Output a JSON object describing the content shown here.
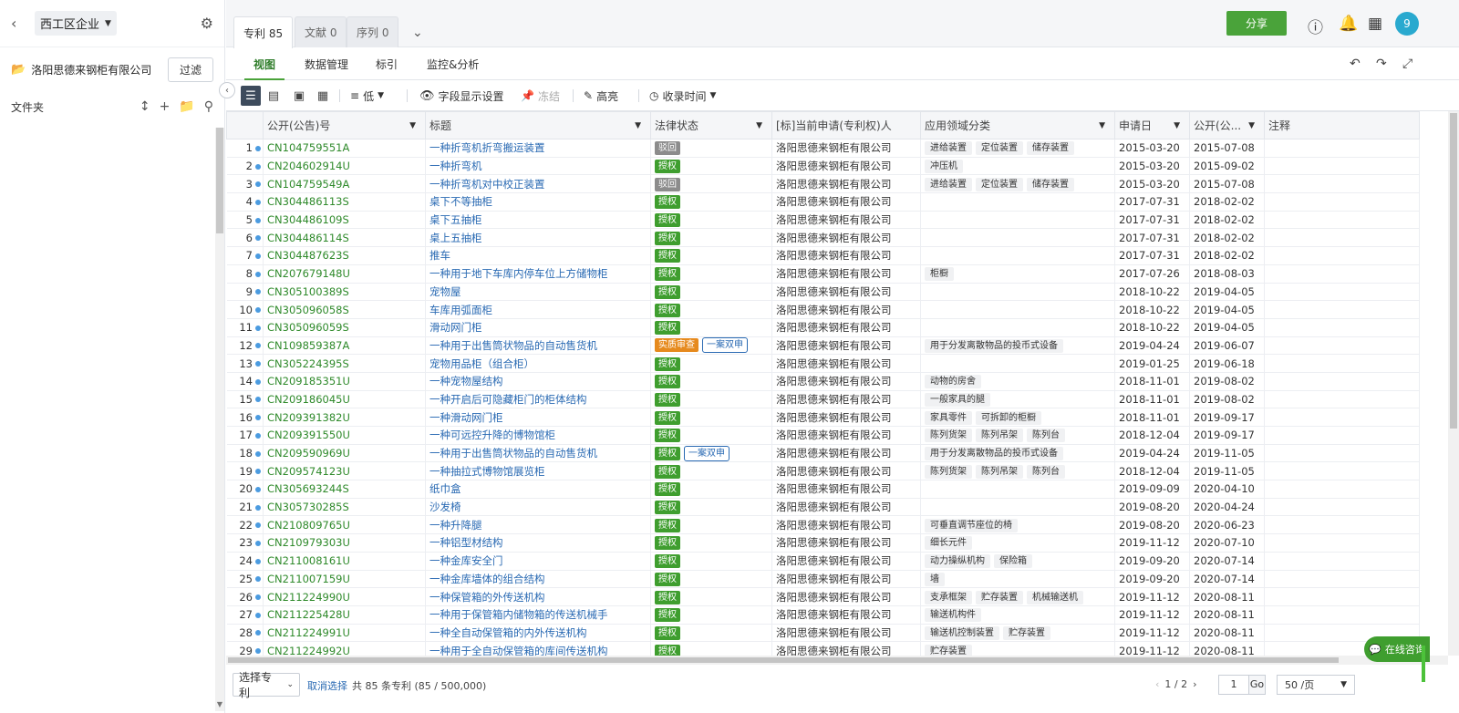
{
  "sidebar": {
    "group": "西工区企业",
    "org": "洛阳思德来钢柜有限公司",
    "filter_label": "过滤",
    "folder_label": "文件夹"
  },
  "tabs": [
    {
      "label": "专利 85"
    },
    {
      "label": "文献 0"
    },
    {
      "label": "序列 0"
    }
  ],
  "header": {
    "share_label": "分享",
    "avatar_text": "9"
  },
  "subtabs": [
    "视图",
    "数据管理",
    "标引",
    "监控&分析"
  ],
  "toolbar": {
    "priority_label": "低",
    "field_display_label": "字段显示设置",
    "freeze_label": "冻结",
    "highlight_label": "高亮",
    "collect_time_label": "收录时间"
  },
  "columns": [
    "公开(公告)号",
    "标题",
    "法律状态",
    "[标]当前申请(专利权)人",
    "应用领域分类",
    "申请日",
    "公开(公...",
    "注释"
  ],
  "rows": [
    {
      "n": "1",
      "pn": "CN104759551A",
      "title": "一种折弯机折弯搬运装置",
      "status": [
        {
          "t": "驳回",
          "c": "gray"
        }
      ],
      "owner": "洛阳思德来钢柜有限公司",
      "tags": [
        "进给装置",
        "定位装置",
        "储存装置"
      ],
      "app": "2015-03-20",
      "pub": "2015-07-08"
    },
    {
      "n": "2",
      "pn": "CN204602914U",
      "title": "一种折弯机",
      "status": [
        {
          "t": "授权",
          "c": "green"
        }
      ],
      "owner": "洛阳思德来钢柜有限公司",
      "tags": [
        "冲压机"
      ],
      "app": "2015-03-20",
      "pub": "2015-09-02"
    },
    {
      "n": "3",
      "pn": "CN104759549A",
      "title": "一种折弯机对中校正装置",
      "status": [
        {
          "t": "驳回",
          "c": "gray"
        }
      ],
      "owner": "洛阳思德来钢柜有限公司",
      "tags": [
        "进给装置",
        "定位装置",
        "储存装置"
      ],
      "app": "2015-03-20",
      "pub": "2015-07-08"
    },
    {
      "n": "4",
      "pn": "CN304486113S",
      "title": "桌下不等抽柜",
      "status": [
        {
          "t": "授权",
          "c": "green"
        }
      ],
      "owner": "洛阳思德来钢柜有限公司",
      "tags": [],
      "app": "2017-07-31",
      "pub": "2018-02-02"
    },
    {
      "n": "5",
      "pn": "CN304486109S",
      "title": "桌下五抽柜",
      "status": [
        {
          "t": "授权",
          "c": "green"
        }
      ],
      "owner": "洛阳思德来钢柜有限公司",
      "tags": [],
      "app": "2017-07-31",
      "pub": "2018-02-02"
    },
    {
      "n": "6",
      "pn": "CN304486114S",
      "title": "桌上五抽柜",
      "status": [
        {
          "t": "授权",
          "c": "green"
        }
      ],
      "owner": "洛阳思德来钢柜有限公司",
      "tags": [],
      "app": "2017-07-31",
      "pub": "2018-02-02"
    },
    {
      "n": "7",
      "pn": "CN304487623S",
      "title": "推车",
      "status": [
        {
          "t": "授权",
          "c": "green"
        }
      ],
      "owner": "洛阳思德来钢柜有限公司",
      "tags": [],
      "app": "2017-07-31",
      "pub": "2018-02-02"
    },
    {
      "n": "8",
      "pn": "CN207679148U",
      "title": "一种用于地下车库内停车位上方储物柜",
      "status": [
        {
          "t": "授权",
          "c": "green"
        }
      ],
      "owner": "洛阳思德来钢柜有限公司",
      "tags": [
        "柜橱"
      ],
      "app": "2017-07-26",
      "pub": "2018-08-03"
    },
    {
      "n": "9",
      "pn": "CN305100389S",
      "title": "宠物屋",
      "status": [
        {
          "t": "授权",
          "c": "green"
        }
      ],
      "owner": "洛阳思德来钢柜有限公司",
      "tags": [],
      "app": "2018-10-22",
      "pub": "2019-04-05"
    },
    {
      "n": "10",
      "pn": "CN305096058S",
      "title": "车库用弧面柜",
      "status": [
        {
          "t": "授权",
          "c": "green"
        }
      ],
      "owner": "洛阳思德来钢柜有限公司",
      "tags": [],
      "app": "2018-10-22",
      "pub": "2019-04-05"
    },
    {
      "n": "11",
      "pn": "CN305096059S",
      "title": "滑动网门柜",
      "status": [
        {
          "t": "授权",
          "c": "green"
        }
      ],
      "owner": "洛阳思德来钢柜有限公司",
      "tags": [],
      "app": "2018-10-22",
      "pub": "2019-04-05"
    },
    {
      "n": "12",
      "pn": "CN109859387A",
      "title": "一种用于出售筒状物品的自动售货机",
      "status": [
        {
          "t": "实质审查",
          "c": "orange"
        },
        {
          "t": "一案双申",
          "c": "out"
        }
      ],
      "owner": "洛阳思德来钢柜有限公司",
      "tags": [
        "用于分发离散物品的投币式设备"
      ],
      "app": "2019-04-24",
      "pub": "2019-06-07"
    },
    {
      "n": "13",
      "pn": "CN305224395S",
      "title": "宠物用品柜（组合柜）",
      "status": [
        {
          "t": "授权",
          "c": "green"
        }
      ],
      "owner": "洛阳思德来钢柜有限公司",
      "tags": [],
      "app": "2019-01-25",
      "pub": "2019-06-18"
    },
    {
      "n": "14",
      "pn": "CN209185351U",
      "title": "一种宠物屋结构",
      "status": [
        {
          "t": "授权",
          "c": "green"
        }
      ],
      "owner": "洛阳思德来钢柜有限公司",
      "tags": [
        "动物的房舍"
      ],
      "app": "2018-11-01",
      "pub": "2019-08-02"
    },
    {
      "n": "15",
      "pn": "CN209186045U",
      "title": "一种开启后可隐藏柜门的柜体结构",
      "status": [
        {
          "t": "授权",
          "c": "green"
        }
      ],
      "owner": "洛阳思德来钢柜有限公司",
      "tags": [
        "一般家具的腿"
      ],
      "app": "2018-11-01",
      "pub": "2019-08-02"
    },
    {
      "n": "16",
      "pn": "CN209391382U",
      "title": "一种滑动网门柜",
      "status": [
        {
          "t": "授权",
          "c": "green"
        }
      ],
      "owner": "洛阳思德来钢柜有限公司",
      "tags": [
        "家具零件",
        "可拆卸的柜橱"
      ],
      "app": "2018-11-01",
      "pub": "2019-09-17"
    },
    {
      "n": "17",
      "pn": "CN209391550U",
      "title": "一种可远控升降的博物馆柜",
      "status": [
        {
          "t": "授权",
          "c": "green"
        }
      ],
      "owner": "洛阳思德来钢柜有限公司",
      "tags": [
        "陈列货架",
        "陈列吊架",
        "陈列台"
      ],
      "app": "2018-12-04",
      "pub": "2019-09-17"
    },
    {
      "n": "18",
      "pn": "CN209590969U",
      "title": "一种用于出售筒状物品的自动售货机",
      "status": [
        {
          "t": "授权",
          "c": "green"
        },
        {
          "t": "一案双申",
          "c": "out"
        }
      ],
      "owner": "洛阳思德来钢柜有限公司",
      "tags": [
        "用于分发离散物品的投币式设备"
      ],
      "app": "2019-04-24",
      "pub": "2019-11-05"
    },
    {
      "n": "19",
      "pn": "CN209574123U",
      "title": "一种抽拉式博物馆展览柜",
      "status": [
        {
          "t": "授权",
          "c": "green"
        }
      ],
      "owner": "洛阳思德来钢柜有限公司",
      "tags": [
        "陈列货架",
        "陈列吊架",
        "陈列台"
      ],
      "app": "2018-12-04",
      "pub": "2019-11-05"
    },
    {
      "n": "20",
      "pn": "CN305693244S",
      "title": "纸巾盒",
      "status": [
        {
          "t": "授权",
          "c": "green"
        }
      ],
      "owner": "洛阳思德来钢柜有限公司",
      "tags": [],
      "app": "2019-09-09",
      "pub": "2020-04-10"
    },
    {
      "n": "21",
      "pn": "CN305730285S",
      "title": "沙发椅",
      "status": [
        {
          "t": "授权",
          "c": "green"
        }
      ],
      "owner": "洛阳思德来钢柜有限公司",
      "tags": [],
      "app": "2019-08-20",
      "pub": "2020-04-24"
    },
    {
      "n": "22",
      "pn": "CN210809765U",
      "title": "一种升降腿",
      "status": [
        {
          "t": "授权",
          "c": "green"
        }
      ],
      "owner": "洛阳思德来钢柜有限公司",
      "tags": [
        "可垂直调节座位的椅"
      ],
      "app": "2019-08-20",
      "pub": "2020-06-23"
    },
    {
      "n": "23",
      "pn": "CN210979303U",
      "title": "一种铝型材结构",
      "status": [
        {
          "t": "授权",
          "c": "green"
        }
      ],
      "owner": "洛阳思德来钢柜有限公司",
      "tags": [
        "细长元件"
      ],
      "app": "2019-11-12",
      "pub": "2020-07-10"
    },
    {
      "n": "24",
      "pn": "CN211008161U",
      "title": "一种金库安全门",
      "status": [
        {
          "t": "授权",
          "c": "green"
        }
      ],
      "owner": "洛阳思德来钢柜有限公司",
      "tags": [
        "动力操纵机构",
        "保险箱"
      ],
      "app": "2019-09-20",
      "pub": "2020-07-14"
    },
    {
      "n": "25",
      "pn": "CN211007159U",
      "title": "一种金库墙体的组合结构",
      "status": [
        {
          "t": "授权",
          "c": "green"
        }
      ],
      "owner": "洛阳思德来钢柜有限公司",
      "tags": [
        "墙"
      ],
      "app": "2019-09-20",
      "pub": "2020-07-14"
    },
    {
      "n": "26",
      "pn": "CN211224990U",
      "title": "一种保管箱的外传送机构",
      "status": [
        {
          "t": "授权",
          "c": "green"
        }
      ],
      "owner": "洛阳思德来钢柜有限公司",
      "tags": [
        "支承框架",
        "贮存装置",
        "机械输送机"
      ],
      "app": "2019-11-12",
      "pub": "2020-08-11"
    },
    {
      "n": "27",
      "pn": "CN211225428U",
      "title": "一种用于保管箱内储物箱的传送机械手",
      "status": [
        {
          "t": "授权",
          "c": "green"
        }
      ],
      "owner": "洛阳思德来钢柜有限公司",
      "tags": [
        "输送机构件"
      ],
      "app": "2019-11-12",
      "pub": "2020-08-11"
    },
    {
      "n": "28",
      "pn": "CN211224991U",
      "title": "一种全自动保管箱的内外传送机构",
      "status": [
        {
          "t": "授权",
          "c": "green"
        }
      ],
      "owner": "洛阳思德来钢柜有限公司",
      "tags": [
        "输送机控制装置",
        "贮存装置"
      ],
      "app": "2019-11-12",
      "pub": "2020-08-11"
    },
    {
      "n": "29",
      "pn": "CN211224992U",
      "title": "一种用于全自动保管箱的库间传送机构",
      "status": [
        {
          "t": "授权",
          "c": "green"
        }
      ],
      "owner": "洛阳思德来钢柜有限公司",
      "tags": [
        "贮存装置"
      ],
      "app": "2019-11-12",
      "pub": "2020-08-11"
    }
  ],
  "footer": {
    "select_label": "选择专利",
    "cancel_label": "取消选择",
    "total_text": "共 85 条专利 (85 / 500,000)",
    "page_text": "1 / 2",
    "page_input": "1",
    "go_label": "Go",
    "page_size": "50 /页"
  },
  "chat_label": "在线咨询",
  "colors": {
    "accent": "#4aa33a",
    "link": "#2a6ab3",
    "patent_number": "#2f8a2b"
  }
}
